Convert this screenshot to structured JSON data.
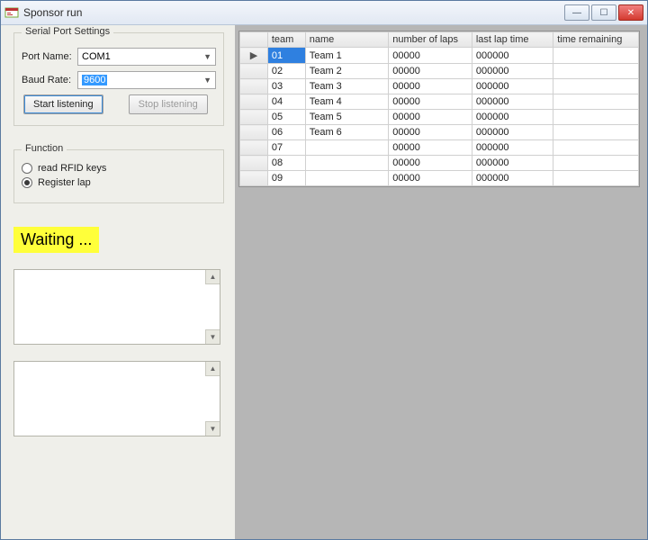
{
  "window": {
    "title": "Sponsor run"
  },
  "serial": {
    "group_title": "Serial Port Settings",
    "port_label": "Port Name:",
    "port_value": "COM1",
    "baud_label": "Baud Rate:",
    "baud_value": "9600",
    "start_label": "Start listening",
    "stop_label": "Stop listening"
  },
  "func": {
    "group_title": "Function",
    "opt1": "read RFID keys",
    "opt2": "Register lap",
    "selected": "opt2"
  },
  "status_text": "Waiting ...",
  "table": {
    "headers": {
      "team": "team",
      "name": "name",
      "laps": "number of laps",
      "last": "last lap time",
      "remain": "time remaining"
    },
    "rows": [
      {
        "team": "01",
        "name": "Team 1",
        "laps": "00000",
        "last": "000000",
        "remain": ""
      },
      {
        "team": "02",
        "name": "Team 2",
        "laps": "00000",
        "last": "000000",
        "remain": ""
      },
      {
        "team": "03",
        "name": "Team 3",
        "laps": "00000",
        "last": "000000",
        "remain": ""
      },
      {
        "team": "04",
        "name": "Team 4",
        "laps": "00000",
        "last": "000000",
        "remain": ""
      },
      {
        "team": "05",
        "name": "Team 5",
        "laps": "00000",
        "last": "000000",
        "remain": ""
      },
      {
        "team": "06",
        "name": "Team 6",
        "laps": "00000",
        "last": "000000",
        "remain": ""
      },
      {
        "team": "07",
        "name": "",
        "laps": "00000",
        "last": "000000",
        "remain": ""
      },
      {
        "team": "08",
        "name": "",
        "laps": "00000",
        "last": "000000",
        "remain": ""
      },
      {
        "team": "09",
        "name": "",
        "laps": "00000",
        "last": "000000",
        "remain": ""
      }
    ]
  },
  "row_indicator": "▶"
}
